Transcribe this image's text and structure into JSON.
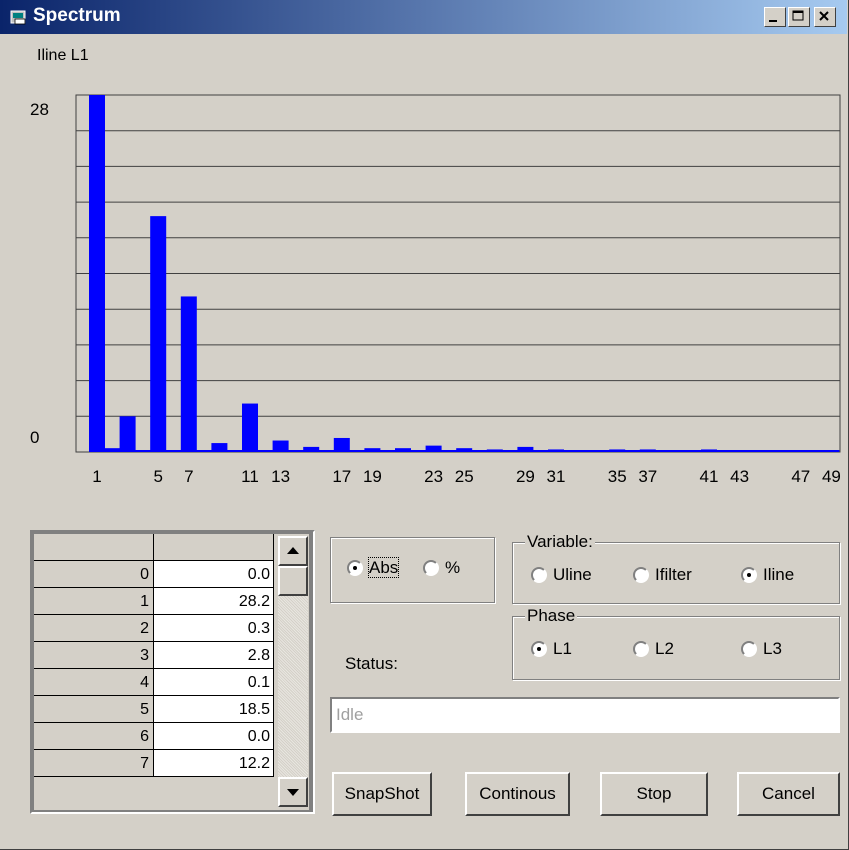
{
  "window": {
    "title": "Spectrum"
  },
  "chart_data": {
    "type": "bar",
    "title": "Iline L1",
    "ylim": [
      0,
      28
    ],
    "ytick_labels": [
      "28",
      "0"
    ],
    "harmonics": [
      1,
      2,
      3,
      4,
      5,
      6,
      7,
      8,
      9,
      10,
      11,
      12,
      13,
      14,
      15,
      16,
      17,
      18,
      19,
      20,
      21,
      22,
      23,
      24,
      25,
      26,
      27,
      28,
      29,
      30,
      31,
      32,
      33,
      34,
      35,
      36,
      37,
      38,
      39,
      40,
      41,
      42,
      43,
      44,
      45,
      46,
      47,
      48,
      49
    ],
    "values": [
      28.2,
      0.3,
      2.8,
      0.1,
      18.5,
      0.0,
      12.2,
      0.1,
      0.7,
      0.1,
      3.8,
      0.1,
      0.9,
      0.1,
      0.4,
      0.1,
      1.1,
      0.1,
      0.3,
      0.1,
      0.3,
      0.1,
      0.5,
      0.1,
      0.3,
      0.1,
      0.2,
      0.1,
      0.4,
      0.1,
      0.2,
      0.1,
      0.1,
      0.1,
      0.2,
      0.1,
      0.2,
      0.1,
      0.1,
      0.1,
      0.2,
      0.1,
      0.1,
      0.1,
      0.1,
      0.1,
      0.1,
      0.1,
      0.1
    ],
    "x_tick_labels": [
      "1",
      "5",
      "7",
      "11",
      "13",
      "17",
      "19",
      "23",
      "25",
      "29",
      "31",
      "35",
      "37",
      "41",
      "43",
      "47",
      "49"
    ],
    "grid": true,
    "bar_color": "#0000ff"
  },
  "table": {
    "rows": [
      {
        "n": "0",
        "v": "0.0"
      },
      {
        "n": "1",
        "v": "28.2"
      },
      {
        "n": "2",
        "v": "0.3"
      },
      {
        "n": "3",
        "v": "2.8"
      },
      {
        "n": "4",
        "v": "0.1"
      },
      {
        "n": "5",
        "v": "18.5"
      },
      {
        "n": "6",
        "v": "0.0"
      },
      {
        "n": "7",
        "v": "12.2"
      }
    ]
  },
  "mode": {
    "abs_label": "Abs",
    "pct_label": "%",
    "selected": "Abs"
  },
  "variable": {
    "title": "Variable:",
    "options": [
      "Uline",
      "Ifilter",
      "Iline"
    ],
    "selected": "Iline"
  },
  "phase": {
    "title": "Phase",
    "options": [
      "L1",
      "L2",
      "L3"
    ],
    "selected": "L1"
  },
  "status": {
    "label": "Status:",
    "value": "Idle"
  },
  "buttons": {
    "snapshot": "SnapShot",
    "continous": "Continous",
    "stop": "Stop",
    "cancel": "Cancel"
  },
  "colors": {
    "titlebar_start": "#0a246a",
    "titlebar_end": "#a6caf0",
    "bars": "#0000ff",
    "face": "#d4d0c8"
  }
}
